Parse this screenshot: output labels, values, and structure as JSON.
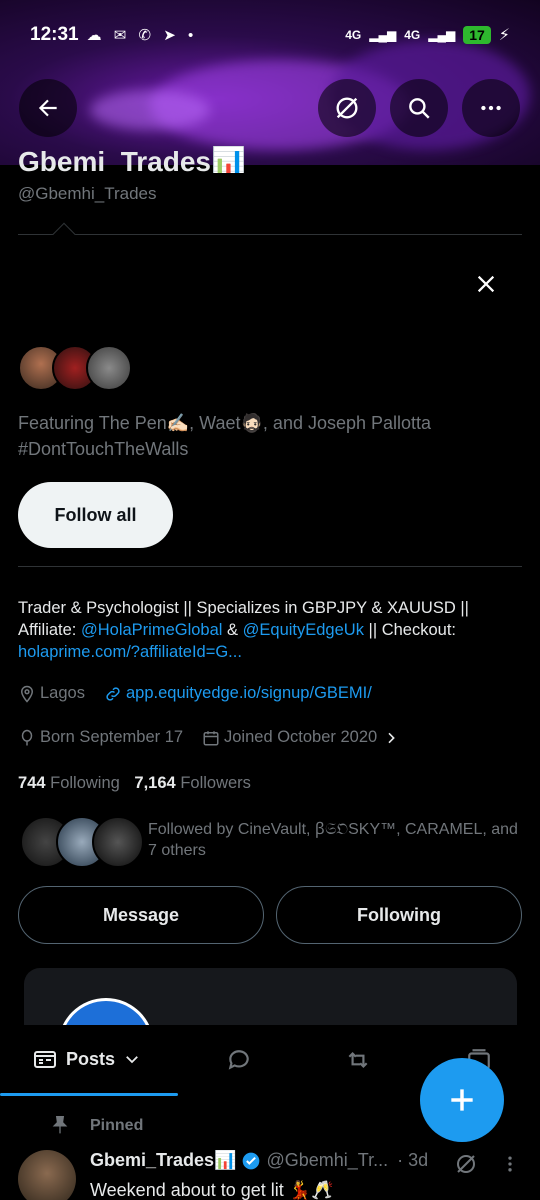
{
  "status_bar": {
    "time": "12:31",
    "notif_icons": "☁ ✉ ✆ ➤ •",
    "net1": "4G",
    "net2": "4G",
    "battery": "17"
  },
  "profile": {
    "name": "Gbemi_Trades📊",
    "handle": "@Gbemhi_Trades",
    "bio_line1": "Trader & Psychologist || Specializes in GBPJPY & XAUUSD ||",
    "bio_affiliate_prefix": "Affiliate: ",
    "bio_mention1": "@HolaPrimeGlobal",
    "bio_amp": " & ",
    "bio_mention2": "@EquityEdgeUk",
    "bio_checkout": " || Checkout:",
    "bio_link": "holaprime.com/?affiliateId=G...",
    "location": "Lagos",
    "website": "app.equityedge.io/signup/GBEMI/",
    "born": "Born September 17",
    "joined": "Joined October 2020",
    "following_count": "744",
    "following_label": "Following",
    "followers_count": "7,164",
    "followers_label": "Followers",
    "followed_by": "Followed by CineVault, ꞵ𝔖𝔒SKY™, CARAMEL, and 7 others"
  },
  "suggestions": {
    "featuring": "Featuring The Pen✍🏻, Waet🧔🏻, and Joseph Pallotta #DontTouchTheWalls",
    "follow_all_label": "Follow all"
  },
  "actions": {
    "message_label": "Message",
    "following_label": "Following"
  },
  "tabs": {
    "posts_label": "Posts"
  },
  "pinned_post": {
    "pinned_label": "Pinned",
    "author": "Gbemi_Trades📊",
    "handle": "@Gbemhi_Tr...",
    "age": "· 3d",
    "text": "Weekend about to get lit 💃🥂"
  },
  "colors": {
    "accent": "#1d9bf0",
    "background": "#000000",
    "muted": "#71767b",
    "banner": "#6a1aa8"
  }
}
